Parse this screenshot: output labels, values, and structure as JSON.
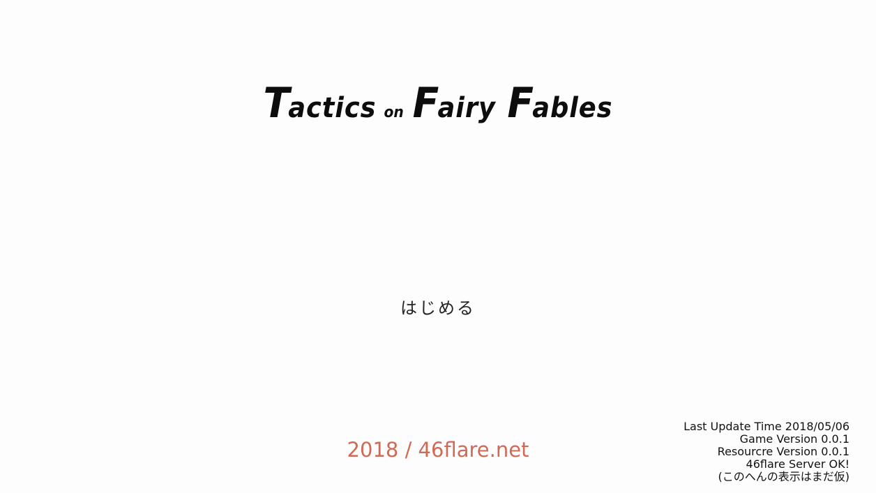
{
  "title": {
    "word1_initial": "T",
    "word1_rest": "actics",
    "connector": "on",
    "word2_initial": "F",
    "word2_rest": "airy",
    "word3_initial": "F",
    "word3_rest": "ables"
  },
  "menu": {
    "start_label": "はじめる"
  },
  "footer": {
    "copyright": "2018 / 46flare.net"
  },
  "version_info": {
    "last_update": "Last Update Time 2018/05/06",
    "game_version": "Game Version 0.0.1",
    "resource_version": "Resourcre Version 0.0.1",
    "server_status": "46flare Server OK!",
    "note": "(このへんの表示はまだ仮)"
  },
  "colors": {
    "background": "#fdfdfd",
    "title": "#0d0d0d",
    "copyright": "#cf6a57"
  }
}
